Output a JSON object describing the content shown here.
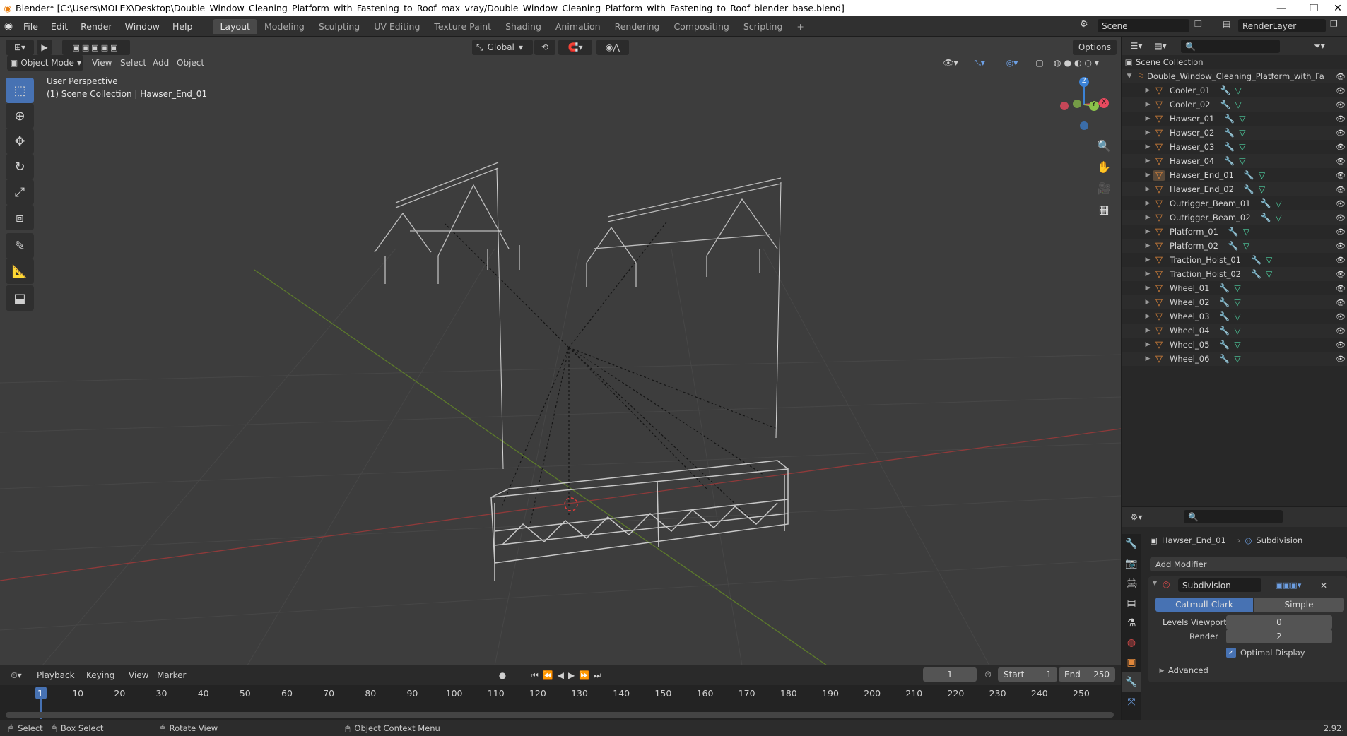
{
  "window": {
    "title": "Blender* [C:\\Users\\MOLEX\\Desktop\\Double_Window_Cleaning_Platform_with_Fastening_to_Roof_max_vray/Double_Window_Cleaning_Platform_with_Fastening_to_Roof_blender_base.blend]",
    "minimize": "—",
    "restore": "❐",
    "close": "✕"
  },
  "menus": [
    "File",
    "Edit",
    "Render",
    "Window",
    "Help"
  ],
  "workspaces": [
    "Layout",
    "Modeling",
    "Sculpting",
    "UV Editing",
    "Texture Paint",
    "Shading",
    "Animation",
    "Rendering",
    "Compositing",
    "Scripting",
    "+"
  ],
  "active_workspace": "Layout",
  "scene": {
    "name": "Scene",
    "view_layer": "RenderLayer"
  },
  "viewport": {
    "mode": "Object Mode",
    "menus": [
      "View",
      "Select",
      "Add",
      "Object"
    ],
    "transform_orientation": "Global",
    "options": "Options",
    "info_line1": "User Perspective",
    "info_line2": "(1) Scene Collection | Hawser_End_01",
    "gizmo": {
      "z": "Z",
      "y": "Y",
      "x": "X"
    }
  },
  "outliner": {
    "root": "Scene Collection",
    "collection": "Double_Window_Cleaning_Platform_with_Fa",
    "items": [
      "Cooler_01",
      "Cooler_02",
      "Hawser_01",
      "Hawser_02",
      "Hawser_03",
      "Hawser_04",
      "Hawser_End_01",
      "Hawser_End_02",
      "Outrigger_Beam_01",
      "Outrigger_Beam_02",
      "Platform_01",
      "Platform_02",
      "Traction_Hoist_01",
      "Traction_Hoist_02",
      "Wheel_01",
      "Wheel_02",
      "Wheel_03",
      "Wheel_04",
      "Wheel_05",
      "Wheel_06"
    ],
    "selected": "Hawser_End_01"
  },
  "properties": {
    "object": "Hawser_End_01",
    "modifier_tab": "Subdivision",
    "add_modifier": "Add Modifier",
    "modifier_name": "Subdivision",
    "type_catmull": "Catmull-Clark",
    "type_simple": "Simple",
    "levels_viewport_label": "Levels Viewport",
    "levels_viewport": "0",
    "render_label": "Render",
    "render": "2",
    "optimal_display": "Optimal Display",
    "advanced": "Advanced"
  },
  "timeline": {
    "menus": [
      "Playback",
      "Keying",
      "View",
      "Marker"
    ],
    "current_frame": "1",
    "start_label": "Start",
    "start": "1",
    "end_label": "End",
    "end": "250",
    "ruler": [
      "1",
      "10",
      "20",
      "30",
      "40",
      "50",
      "60",
      "70",
      "80",
      "90",
      "100",
      "110",
      "120",
      "130",
      "140",
      "150",
      "160",
      "170",
      "180",
      "190",
      "200",
      "210",
      "220",
      "230",
      "240",
      "250"
    ]
  },
  "statusbar": {
    "select": "Select",
    "box_select": "Box Select",
    "rotate_view": "Rotate View",
    "context_menu": "Object Context Menu",
    "version": "2.92."
  },
  "colors": {
    "accent": "#4772b3",
    "x_axis": "#e84a5f",
    "y_axis": "#8bc34a",
    "z_axis": "#3b82d6",
    "mesh": "#e0873b"
  }
}
